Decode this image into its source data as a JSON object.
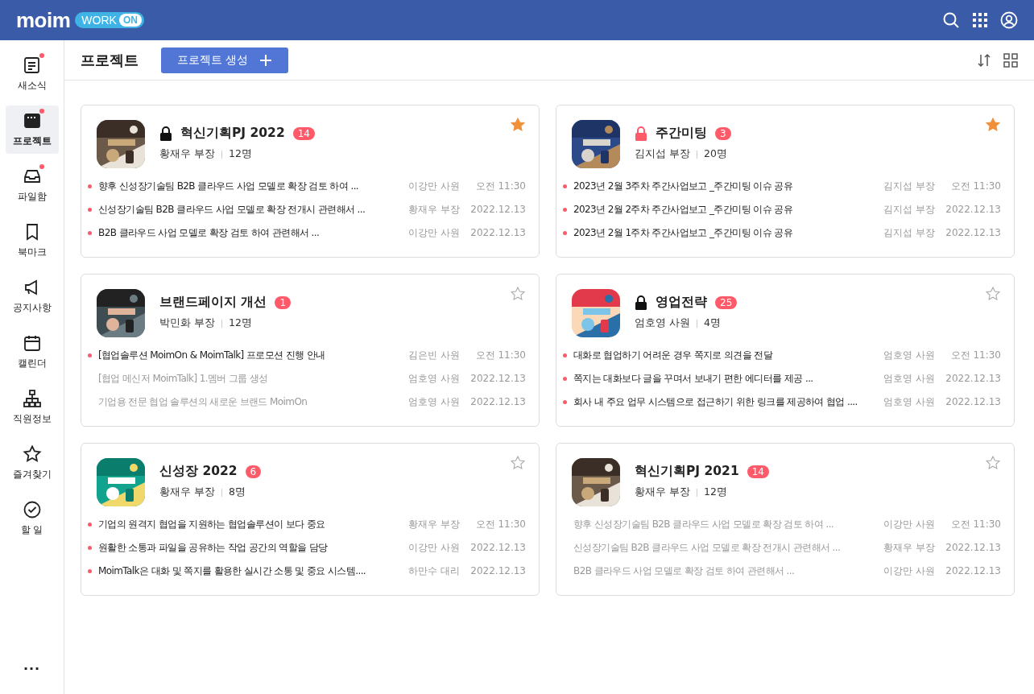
{
  "header": {
    "logo": "moim",
    "logo_badge": "WORK",
    "logo_badge_on": "ON"
  },
  "sidebar": {
    "items": [
      {
        "label": "새소식",
        "selected": false,
        "notify": true
      },
      {
        "label": "프로젝트",
        "selected": true,
        "notify": true
      },
      {
        "label": "파일함",
        "selected": false,
        "notify": true
      },
      {
        "label": "북마크",
        "selected": false,
        "notify": false
      },
      {
        "label": "공지사항",
        "selected": false,
        "notify": false
      },
      {
        "label": "캘린더",
        "selected": false,
        "notify": false
      },
      {
        "label": "직원정보",
        "selected": false,
        "notify": false
      },
      {
        "label": "즐겨찾기",
        "selected": false,
        "notify": false
      },
      {
        "label": "할 일",
        "selected": false,
        "notify": false
      }
    ],
    "more": "..."
  },
  "page": {
    "title": "프로젝트",
    "create_button": "프로젝트 생성"
  },
  "projects": [
    {
      "title": "혁신기획PJ 2022",
      "locked": true,
      "lock_alert": false,
      "badge": "14",
      "owner": "황재우 부장",
      "members": "12명",
      "starred": true,
      "posts": [
        {
          "text": "향후 신성장기술팀 B2B 클라우드 사업 모델로 확장 검토 하여  ...",
          "author": "이강만 사원",
          "time": "오전 11:30",
          "unread": true
        },
        {
          "text": "신성장기술팀 B2B 클라우드 사업 모델로 확장 전개시 관련해서 ...",
          "author": "황재우 부장",
          "time": "2022.12.13",
          "unread": true
        },
        {
          "text": "B2B 클라우드 사업 모델로 확장 검토 하여 관련해서 ...",
          "author": "이강만 사원",
          "time": "2022.12.13",
          "unread": true
        }
      ]
    },
    {
      "title": "주간미팅",
      "locked": true,
      "lock_alert": true,
      "badge": "3",
      "owner": "김지섭 부장",
      "members": "20명",
      "starred": true,
      "posts": [
        {
          "text": "2023년 2월 3주차 주간사업보고 _주간미팅 이슈 공유",
          "author": "김지섭 부장",
          "time": "오전 11:30",
          "unread": true
        },
        {
          "text": "2023년 2월 2주차 주간사업보고 _주간미팅 이슈 공유",
          "author": "김지섭 부장",
          "time": "2022.12.13",
          "unread": true
        },
        {
          "text": "2023년 2월 1주차 주간사업보고 _주간미팅 이슈 공유",
          "author": "김지섭 부장",
          "time": "2022.12.13",
          "unread": true
        }
      ]
    },
    {
      "title": "브랜드페이지 개선",
      "locked": false,
      "badge": "1",
      "owner": "박민화 부장",
      "members": "12명",
      "starred": false,
      "posts": [
        {
          "text": "[협업솔루션 MoimOn & MoimTalk] 프로모션 진행 안내",
          "author": "김은빈 사원",
          "time": "오전 11:30",
          "unread": true
        },
        {
          "text": "[협업 메신저 MoimTalk] 1.멤버 그룹 생성",
          "author": "엄호영 사원",
          "time": "2022.12.13",
          "unread": false
        },
        {
          "text": "기업용 전문 협업 솔루션의 새로운 브랜드 MoimOn",
          "author": "엄호영 사원",
          "time": "2022.12.13",
          "unread": false
        }
      ]
    },
    {
      "title": "영업전략",
      "locked": true,
      "lock_alert": false,
      "badge": "25",
      "owner": "엄호영 사원",
      "members": "4명",
      "starred": false,
      "posts": [
        {
          "text": "대화로 협업하기 어려운 경우 쪽지로 의견을 전달",
          "author": "엄호영 사원",
          "time": "오전 11:30",
          "unread": true
        },
        {
          "text": "쪽지는 대화보다 글을 꾸며서 보내기 편한 에디터를 제공 ...",
          "author": "엄호영 사원",
          "time": "2022.12.13",
          "unread": true
        },
        {
          "text": "회사 내 주요 업무 시스템으로 접근하기 위한 링크를 제공하여 협업 ....",
          "author": "엄호영 사원",
          "time": "2022.12.13",
          "unread": true
        }
      ]
    },
    {
      "title": "신성장 2022",
      "locked": false,
      "badge": "6",
      "owner": "황재우 부장",
      "members": "8명",
      "starred": false,
      "posts": [
        {
          "text": "기업의 원격지 협업을 지원하는 협업솔루션이 보다 중요",
          "author": "황재우 부장",
          "time": "오전 11:30",
          "unread": true
        },
        {
          "text": "원활한 소통과 파일을 공유하는 작업 공간의 역할을 담당",
          "author": "이강만 사원",
          "time": "2022.12.13",
          "unread": true
        },
        {
          "text": "MoimTalk은 대화 및 쪽지를 활용한 실시간 소통 및 중요 시스템....",
          "author": "하만수 대리",
          "time": "2022.12.13",
          "unread": true
        }
      ]
    },
    {
      "title": "혁신기획PJ 2021",
      "locked": false,
      "badge": "14",
      "owner": "황재우 부장",
      "members": "12명",
      "starred": false,
      "posts": [
        {
          "text": "향후 신성장기술팀 B2B 클라우드 사업 모델로 확장 검토 하여  ...",
          "author": "이강만 사원",
          "time": "오전 11:30",
          "unread": false
        },
        {
          "text": "신성장기술팀 B2B 클라우드 사업 모델로 확장 전개시 관련해서 ...",
          "author": "황재우 부장",
          "time": "2022.12.13",
          "unread": false
        },
        {
          "text": "B2B 클라우드 사업 모델로 확장 검토 하여 관련해서 ...",
          "author": "이강만 사원",
          "time": "2022.12.13",
          "unread": false
        }
      ]
    }
  ]
}
